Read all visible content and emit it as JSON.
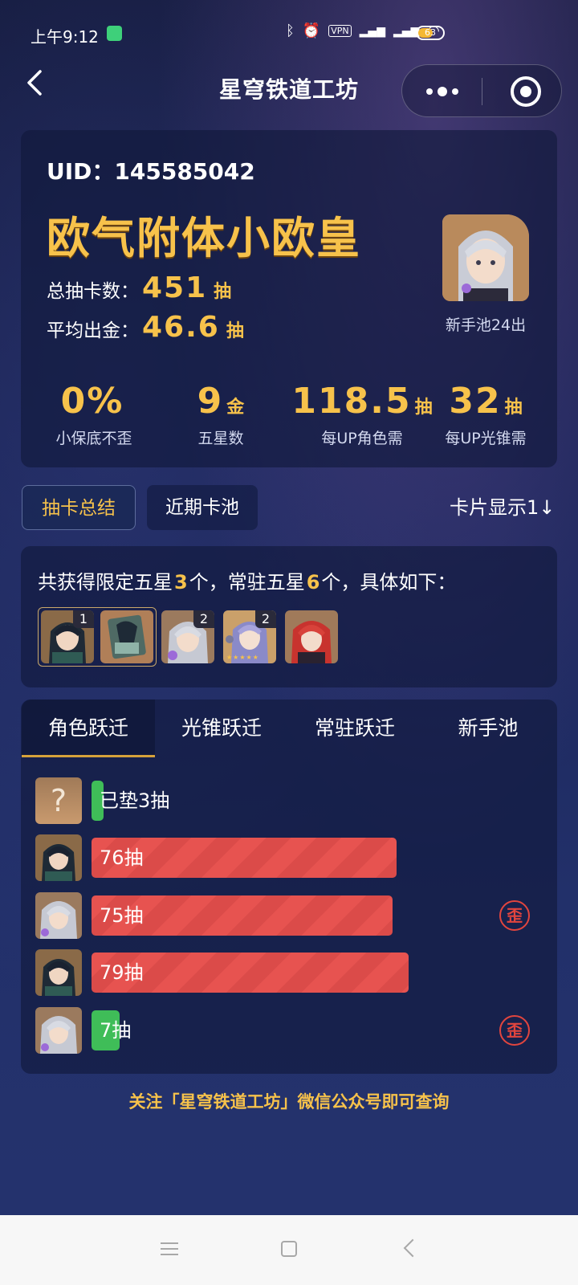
{
  "status_bar": {
    "time": "上午9:12",
    "vpn": "VPN",
    "battery": "63"
  },
  "header": {
    "title": "星穹铁道工坊"
  },
  "summary": {
    "uid": "UID：145585042",
    "rank_title": "欧气附体小欧皇",
    "total_label": "总抽卡数：",
    "total_value": "451",
    "total_unit": "抽",
    "avg_label": "平均出金：",
    "avg_value": "46.6",
    "avg_unit": "抽",
    "avatar_caption": "新手池24出",
    "metrics": [
      {
        "value": "0%",
        "unit": "",
        "label": "小保底不歪"
      },
      {
        "value": "9",
        "unit": "金",
        "label": "五星数"
      },
      {
        "value": "118.5",
        "unit": "抽",
        "label": "每UP角色需"
      },
      {
        "value": "32",
        "unit": "抽",
        "label": "每UP光锥需"
      }
    ]
  },
  "tabs": {
    "summary": "抽卡总结",
    "recent": "近期卡池",
    "card_toggle": "卡片显示1↓"
  },
  "fivestar": {
    "prefix": "共获得限定五星",
    "limited_count": "3",
    "middle": "个，常驻五星",
    "standard_count": "6",
    "suffix": "个，具体如下：",
    "thumb_counts": [
      "1",
      "2",
      "2"
    ]
  },
  "transfer": {
    "tabs": [
      "角色跃迁",
      "光锥跃迁",
      "常驻跃迁",
      "新手池"
    ],
    "rows": [
      {
        "label": "已垫3抽",
        "pulls": 3,
        "type": "green",
        "lost_5050": false
      },
      {
        "label": "76抽",
        "pulls": 76,
        "type": "red",
        "lost_5050": false
      },
      {
        "label": "75抽",
        "pulls": 75,
        "type": "red",
        "lost_5050": true
      },
      {
        "label": "79抽",
        "pulls": 79,
        "type": "red",
        "lost_5050": false
      },
      {
        "label": "7抽",
        "pulls": 7,
        "type": "green",
        "lost_5050": true
      }
    ],
    "wai_glyph": "歪",
    "unknown_glyph": "?"
  },
  "footer_note": "关注「星穹铁道工坊」微信公众号即可查询",
  "colors": {
    "accent_gold": "#f7c24b",
    "bar_red": "#e75350",
    "bar_green": "#3fbd58"
  }
}
